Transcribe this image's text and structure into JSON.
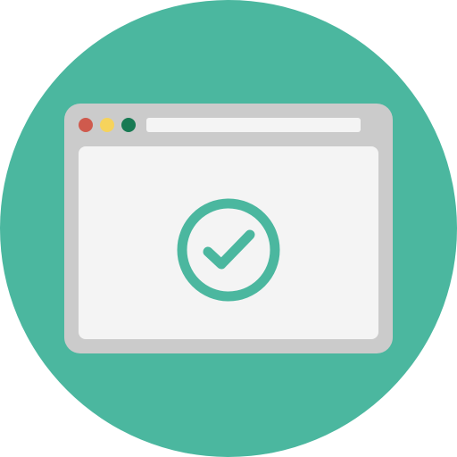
{
  "icon": {
    "name": "browser-window-checkmark-icon",
    "colors": {
      "background_circle": "#4BB79F",
      "window_frame": "#CBCBCB",
      "window_content": "#F4F4F4",
      "address_bar": "#F4F4F4",
      "dot_red": "#CF5A4D",
      "dot_yellow": "#F6D35C",
      "dot_green": "#187A53",
      "checkmark": "#4BB79F"
    }
  }
}
